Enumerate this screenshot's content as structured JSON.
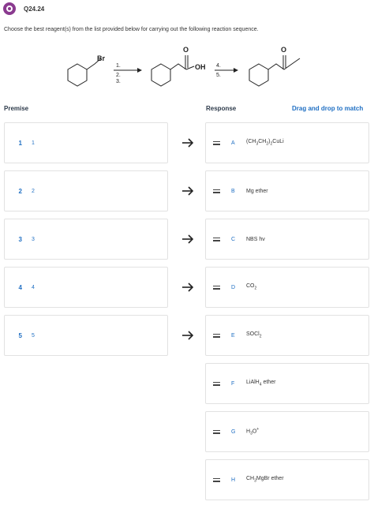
{
  "question": {
    "id": "Q24.24",
    "instruction": "Choose the best reagent(s) from the list provided below for carrying out the following reaction sequence."
  },
  "scheme": {
    "left_group": "Br",
    "steps_first": [
      "1.",
      "2.",
      "3."
    ],
    "middle_group": "OH",
    "carbonyl_o": "O",
    "steps_second": [
      "4.",
      "5."
    ]
  },
  "columns": {
    "premise": "Premise",
    "response": "Response",
    "drag_hint": "Drag and drop to match"
  },
  "premises": [
    {
      "num": "1",
      "text": "1"
    },
    {
      "num": "2",
      "text": "2"
    },
    {
      "num": "3",
      "text": "3"
    },
    {
      "num": "4",
      "text": "4"
    },
    {
      "num": "5",
      "text": "5"
    }
  ],
  "responses": [
    {
      "letter": "A",
      "text": "(CH3CH2)2CuLi"
    },
    {
      "letter": "B",
      "text": "Mg ether"
    },
    {
      "letter": "C",
      "text": "NBS hν"
    },
    {
      "letter": "D",
      "text": "CO2"
    },
    {
      "letter": "E",
      "text": "SOCl2"
    },
    {
      "letter": "F",
      "text": "LiAlH4 ether"
    },
    {
      "letter": "G",
      "text": "H3O+"
    },
    {
      "letter": "H",
      "text": "CH3MgBr ether"
    }
  ],
  "colors": {
    "accent": "#1f6fc3",
    "icon": "#8a3a8f",
    "border": "#e2e2e2"
  }
}
